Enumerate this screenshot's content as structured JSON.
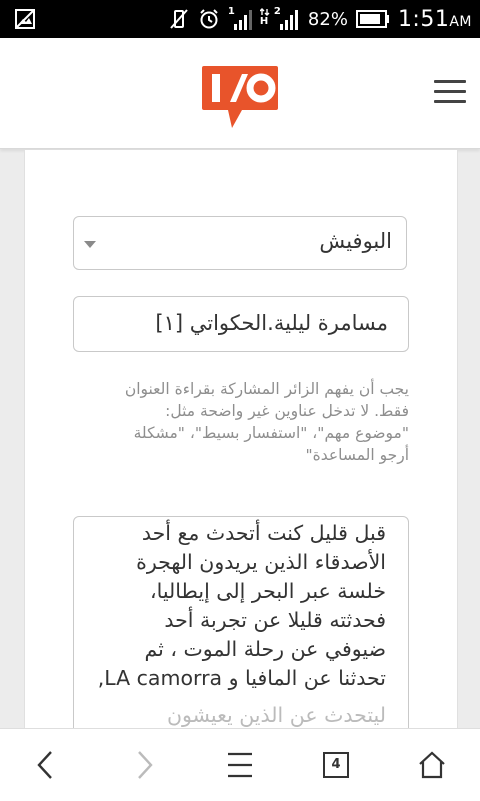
{
  "status_bar": {
    "battery_percent": "82%",
    "time": "1:51",
    "ampm": "AM",
    "sim1_label": "1",
    "sim2_label": "2",
    "network_type": "H"
  },
  "form": {
    "forum_select_value": "البوفيش",
    "title_value": "مسامرة ليلية.الحكواتي [۱]",
    "help_lines": [
      "يجب أن يفهم الزائر المشاركة بقراءة العنوان",
      "فقط. لا تدخل عناوين غير واضحة مثل:",
      "\"موضوع مهم\"، \"استفسار بسيط\"، \"مشكلة",
      "أرجو المساعدة\""
    ],
    "body_lines": [
      "قبل قليل كنت أتحدث مع أحد",
      "الأصدقاء الذين يريدون الهجرة",
      "خلسة عبر البحر إلى إيطاليا،",
      "فحدثته قليلا عن تجربة أحد",
      "ضيوفي عن رحلة الموت ، ثم",
      "تحدثنا عن المافيا و LA camorra,",
      "ليتحدث عن الذين يعيشون"
    ]
  },
  "browser_nav": {
    "tab_count": "4"
  },
  "colors": {
    "brand": "#e8542b",
    "status_bar_bg": "#000000"
  }
}
